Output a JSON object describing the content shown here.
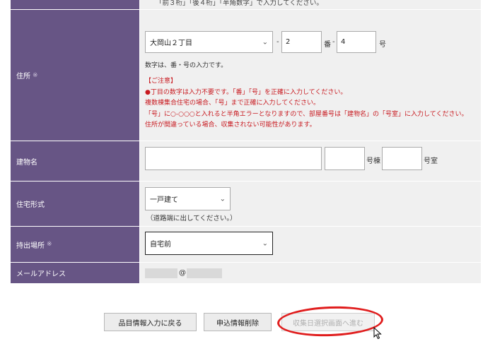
{
  "phone_note": "「前３桁」「後４桁」「半角数字」で入力してください。",
  "address": {
    "label": "住所",
    "required_mark": "※",
    "area_select": "大岡山２丁目",
    "dash1": "-",
    "banchi_value": "2",
    "ban_unit": "番",
    "dash2": "-",
    "go_value": "4",
    "go_unit": "号",
    "hint": "数字は、番・号の入力です。",
    "notes": [
      "【ご注意】",
      "●丁目の数字は入力不要です。「番」「号」を正確に入力してください。",
      "複数棟集合住宅の場合、「号」まで正確に入力してください。",
      "「号」に○-○○○と入れると半角エラーとなりますので、部屋番号は「建物名」の「号室」に入力してください。",
      "住所が間違っている場合、収集されない可能性があります。"
    ]
  },
  "building": {
    "label": "建物名",
    "name_value": "",
    "wing_value": "",
    "wing_unit": "号棟",
    "room_value": "",
    "room_unit": "号室"
  },
  "housing": {
    "label": "住宅形式",
    "selected": "一戸建て",
    "note": "（道路端に出してください。）"
  },
  "place": {
    "label": "持出場所",
    "required_mark": "※",
    "selected": "自宅前"
  },
  "mail": {
    "label": "メールアドレス",
    "at": "@"
  },
  "buttons": {
    "back": "品目情報入力に戻る",
    "delete": "申込情報削除",
    "next": "収集日選択画面へ進む"
  },
  "colors": {
    "label_bg": "#675585",
    "cell_bg": "#f0f0f0",
    "note_red": "#c8191f",
    "highlight_circle": "#e01d1d"
  }
}
